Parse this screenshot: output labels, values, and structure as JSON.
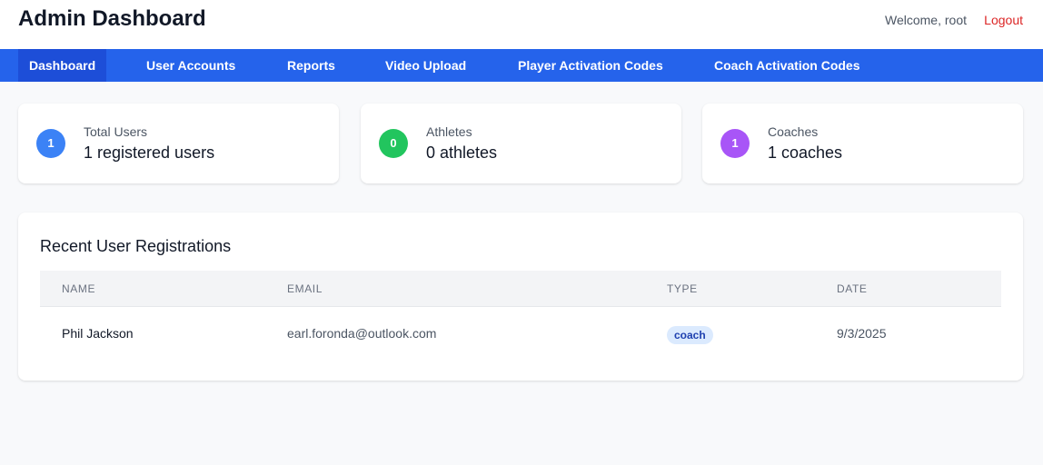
{
  "header": {
    "title": "Admin Dashboard",
    "welcome": "Welcome, root",
    "logout": "Logout"
  },
  "nav": {
    "items": [
      "Dashboard",
      "User Accounts",
      "Reports",
      "Video Upload",
      "Player Activation Codes",
      "Coach Activation Codes"
    ],
    "active": "Dashboard"
  },
  "stats": [
    {
      "count": "1",
      "label": "Total Users",
      "value": "1 registered users",
      "color": "#3b82f6"
    },
    {
      "count": "0",
      "label": "Athletes",
      "value": "0 athletes",
      "color": "#22c55e"
    },
    {
      "count": "1",
      "label": "Coaches",
      "value": "1 coaches",
      "color": "#a855f7"
    }
  ],
  "recent": {
    "title": "Recent User Registrations",
    "columns": [
      "NAME",
      "EMAIL",
      "TYPE",
      "DATE"
    ],
    "rows": [
      {
        "name": "Phil Jackson",
        "email": "earl.foronda@outlook.com",
        "type": "coach",
        "date": "9/3/2025"
      }
    ]
  }
}
